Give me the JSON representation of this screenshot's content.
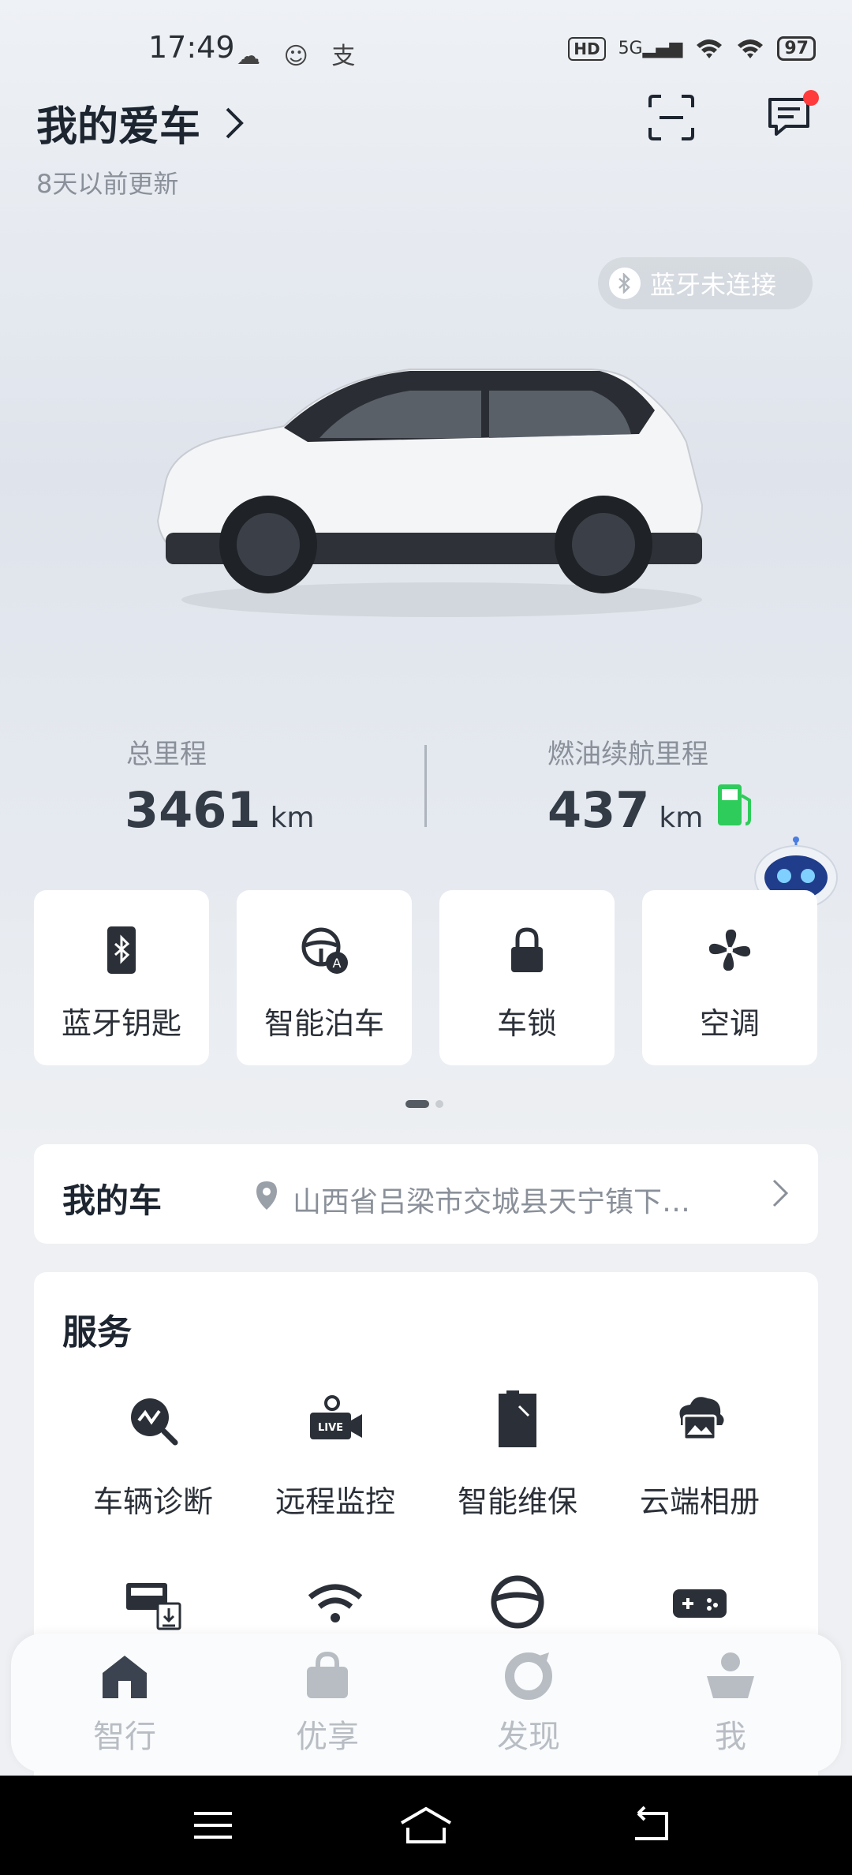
{
  "status_bar": {
    "time": "17:49",
    "left_icons": "☁ ☺ 支",
    "hd": "HD",
    "network": "5G",
    "battery": "97"
  },
  "header": {
    "title": "我的爱车",
    "subtitle": "8天以前更新"
  },
  "bluetooth_pill": {
    "label": "蓝牙未连接"
  },
  "stats": {
    "total_mileage": {
      "label": "总里程",
      "value": "3461",
      "unit": "km"
    },
    "fuel_range": {
      "label": "燃油续航里程",
      "value": "437",
      "unit": "km"
    }
  },
  "quick_actions": [
    {
      "label": "蓝牙钥匙",
      "icon": "bluetooth-key-icon"
    },
    {
      "label": "智能泊车",
      "icon": "smart-parking-icon"
    },
    {
      "label": "车锁",
      "icon": "lock-icon"
    },
    {
      "label": "空调",
      "icon": "fan-icon"
    }
  ],
  "my_car": {
    "title": "我的车",
    "location": "山西省吕梁市交城县天宁镇下…"
  },
  "services": {
    "title": "服务",
    "items": [
      {
        "label": "车辆诊断",
        "icon": "diagnosis-icon"
      },
      {
        "label": "远程监控",
        "icon": "live-camera-icon"
      },
      {
        "label": "智能维保",
        "icon": "maintenance-icon"
      },
      {
        "label": "云端相册",
        "icon": "cloud-album-icon"
      },
      {
        "label": "",
        "icon": "download-device-icon"
      },
      {
        "label": "",
        "icon": "wifi-icon"
      },
      {
        "label": "",
        "icon": "steering-wheel-icon"
      },
      {
        "label": "",
        "icon": "gamepad-icon"
      }
    ]
  },
  "tabbar": {
    "tabs": [
      {
        "label": "智行",
        "active": true
      },
      {
        "label": "优享",
        "active": false
      },
      {
        "label": "发现",
        "active": false
      },
      {
        "label": "我",
        "active": false
      }
    ]
  },
  "colors": {
    "active": "#3b4350",
    "inactive": "#b8bdc4",
    "fuel_green": "#2ecc5a",
    "notify_red": "#ff3b3b"
  }
}
